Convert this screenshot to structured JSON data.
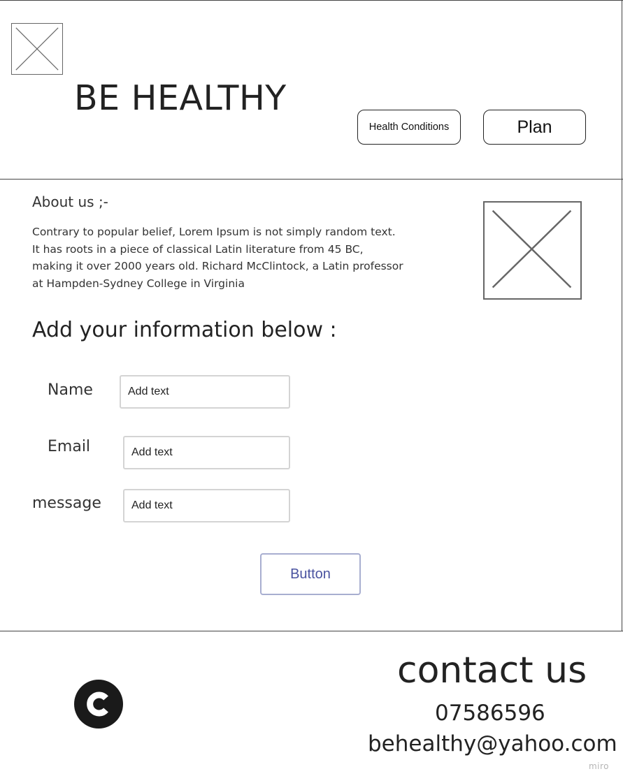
{
  "header": {
    "title": "BE HEALTHY",
    "nav": {
      "health_conditions_label": "Health Conditions",
      "plan_label": "Plan"
    }
  },
  "about": {
    "title": "About us ;-",
    "text_lines": [
      "Contrary to popular belief, Lorem Ipsum is not simply random text.",
      "It has roots in a piece of classical Latin literature from 45 BC,",
      "making it over 2000 years old. Richard McClintock, a Latin professor",
      "at Hampden-Sydney College in Virginia"
    ]
  },
  "form": {
    "heading": "Add your information below :",
    "fields": [
      {
        "label": "Name",
        "placeholder": "Add text"
      },
      {
        "label": "Email",
        "placeholder": "Add text"
      },
      {
        "label": "message",
        "placeholder": "Add text"
      }
    ],
    "submit_label": "Button"
  },
  "footer": {
    "logo_icon": "copyright-c-icon",
    "contact_title": "contact us",
    "phone": "07586596",
    "email": "behealthy@yahoo.com",
    "watermark": "miro"
  },
  "colors": {
    "line": "#444444",
    "button_accent": "#4a53a0",
    "button_border": "#a8aed0",
    "logo": "#1a1a1a"
  }
}
